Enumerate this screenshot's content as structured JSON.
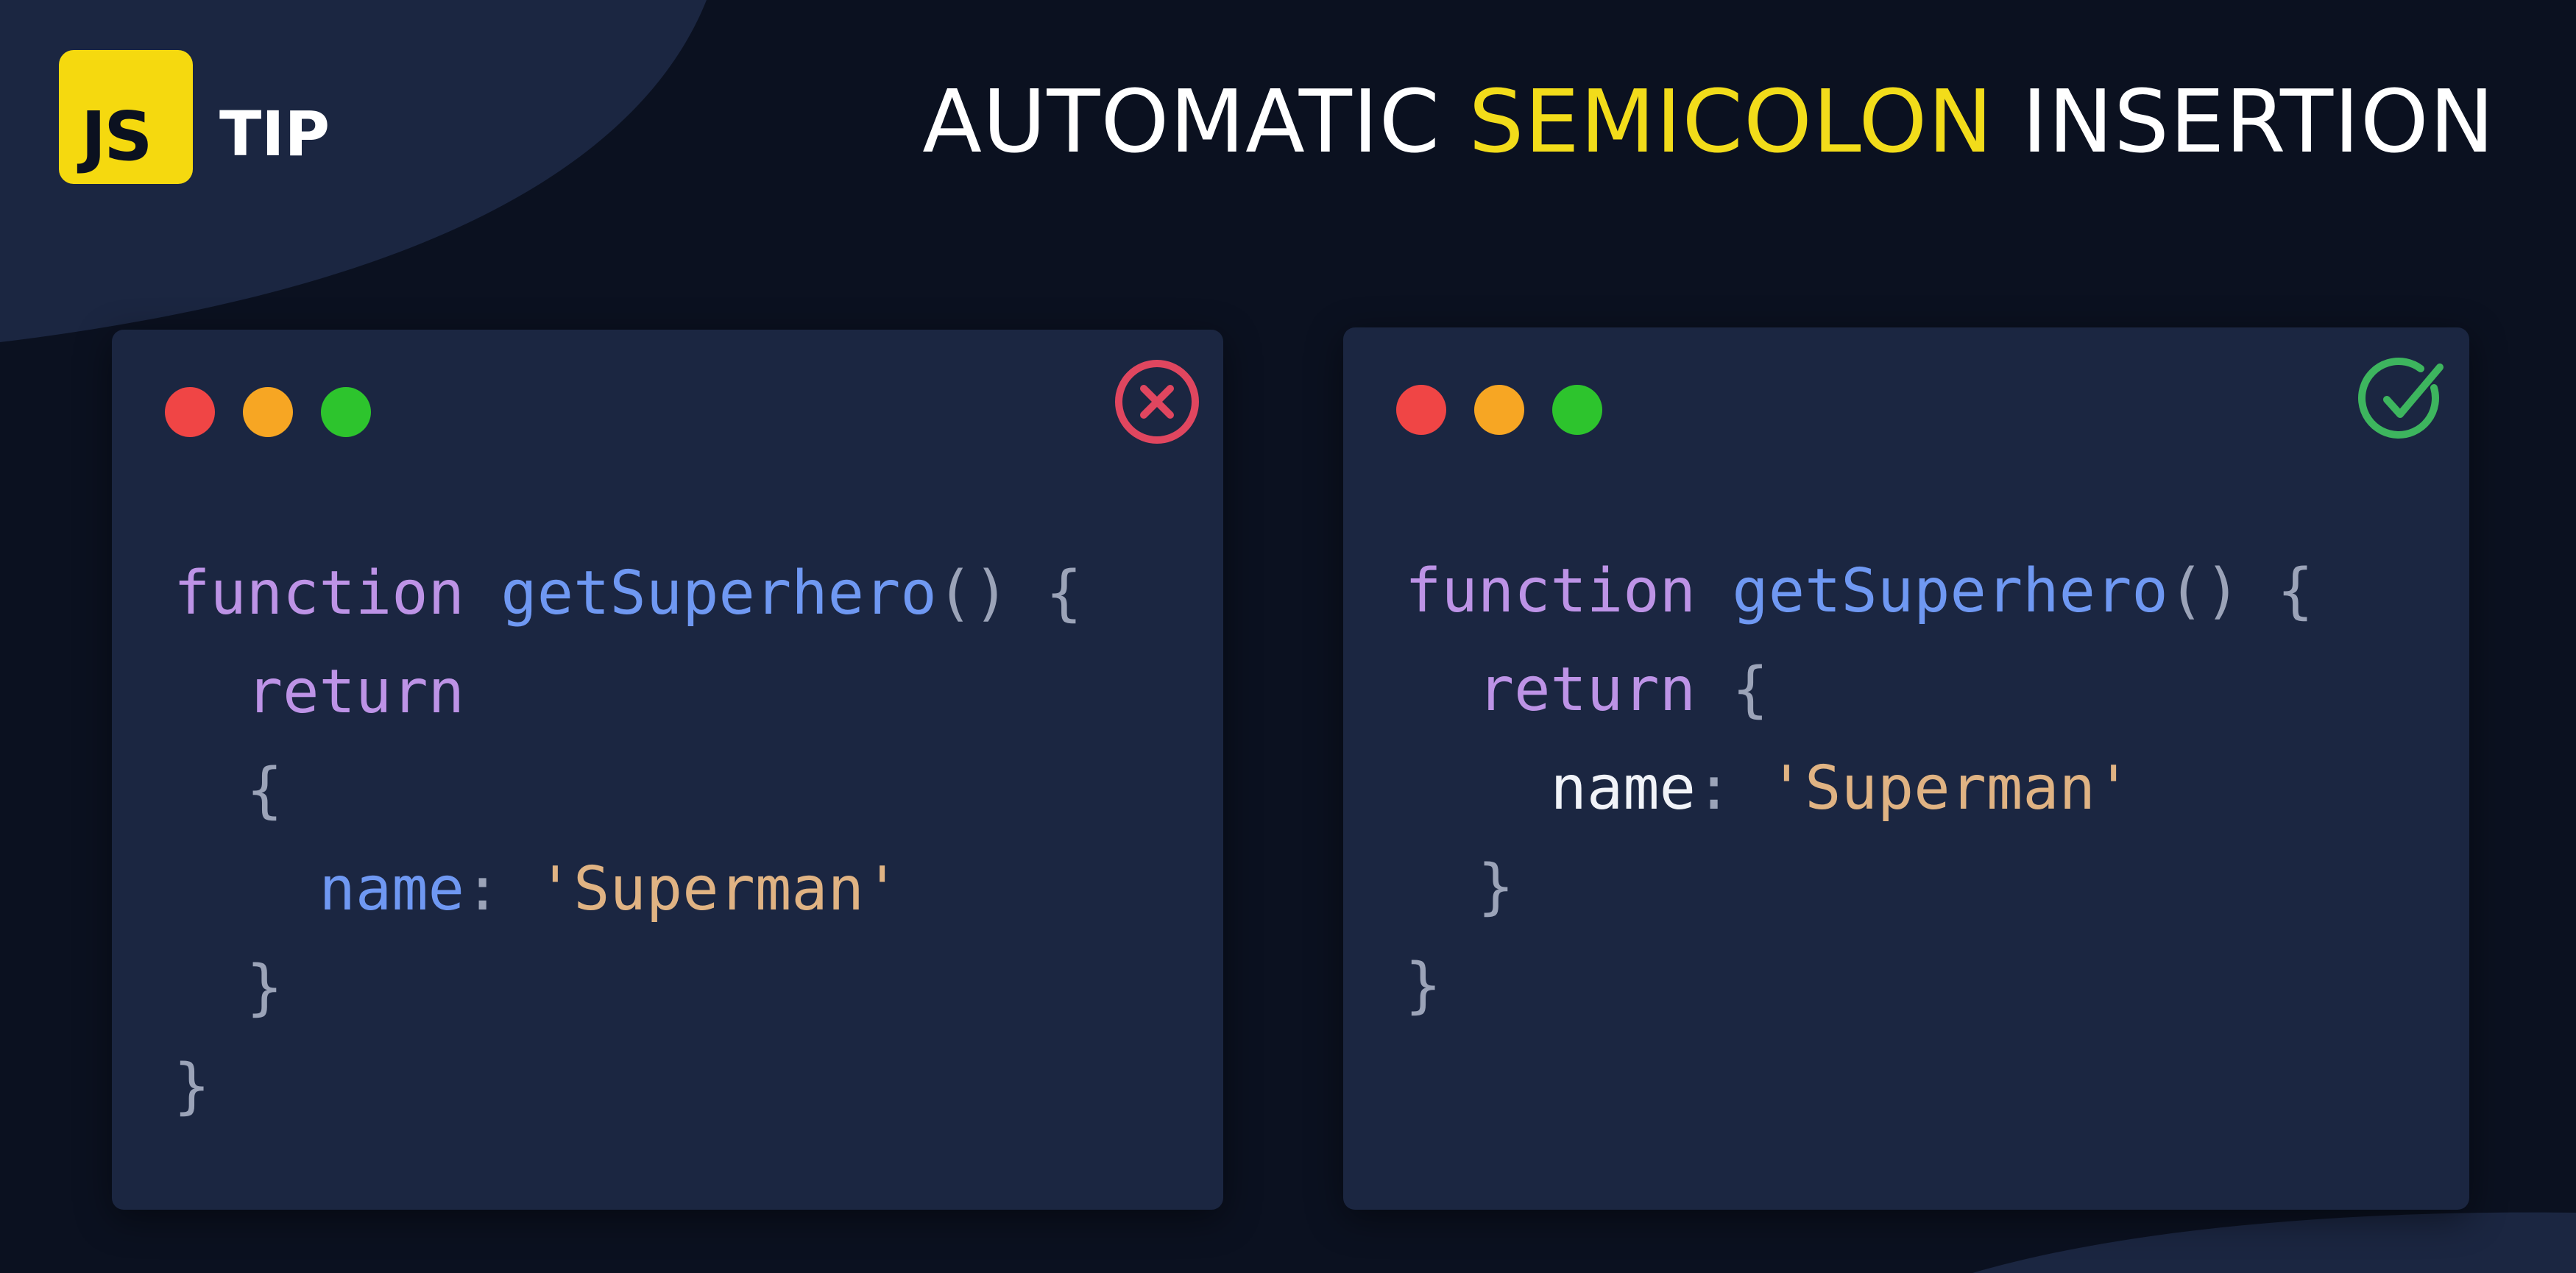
{
  "badge": {
    "logo_text": "JS",
    "tip_label": "TIP"
  },
  "title": {
    "part1": "AUTOMATIC ",
    "highlight": "SEMICOLON",
    "part2": " INSERTION"
  },
  "colors": {
    "background": "#0b1120",
    "blob": "#1b2641",
    "window": "#1b2641",
    "brand_yellow": "#f5d90f",
    "title_highlight": "#f2dc1a",
    "dot_red": "#f04545",
    "dot_yellow": "#f7a623",
    "dot_green": "#2dc42d",
    "error": "#e0465f",
    "success": "#3db55e",
    "keyword": "#bd93e6",
    "function_name": "#6f98f2",
    "punctuation": "#9ba3b8",
    "property_bad": "#6f98f2",
    "property_good": "#f1f3f8",
    "string": "#e0b383"
  },
  "windows": [
    {
      "id": "incorrect",
      "status_icon": "x-circle-icon",
      "status_color": "#e0465f",
      "lines": [
        [
          {
            "text": "function",
            "cls": "keyword"
          },
          {
            "text": " ",
            "cls": "plain"
          },
          {
            "text": "getSuperhero",
            "cls": "function_name"
          },
          {
            "text": "() {",
            "cls": "punctuation"
          }
        ],
        [
          {
            "text": "  ",
            "cls": "plain"
          },
          {
            "text": "return",
            "cls": "keyword"
          }
        ],
        [
          {
            "text": "  {",
            "cls": "punctuation"
          }
        ],
        [
          {
            "text": "    ",
            "cls": "plain"
          },
          {
            "text": "name",
            "cls": "property_bad"
          },
          {
            "text": ": ",
            "cls": "punctuation"
          },
          {
            "text": "'Superman'",
            "cls": "string"
          }
        ],
        [
          {
            "text": "  }",
            "cls": "punctuation"
          }
        ],
        [
          {
            "text": "}",
            "cls": "punctuation"
          }
        ]
      ]
    },
    {
      "id": "correct",
      "status_icon": "check-circle-icon",
      "status_color": "#3db55e",
      "lines": [
        [
          {
            "text": "function",
            "cls": "keyword"
          },
          {
            "text": " ",
            "cls": "plain"
          },
          {
            "text": "getSuperhero",
            "cls": "function_name"
          },
          {
            "text": "() {",
            "cls": "punctuation"
          }
        ],
        [
          {
            "text": "  ",
            "cls": "plain"
          },
          {
            "text": "return",
            "cls": "keyword"
          },
          {
            "text": " {",
            "cls": "punctuation"
          }
        ],
        [
          {
            "text": "    ",
            "cls": "plain"
          },
          {
            "text": "name",
            "cls": "property_good"
          },
          {
            "text": ": ",
            "cls": "punctuation"
          },
          {
            "text": "'Superman'",
            "cls": "string"
          }
        ],
        [
          {
            "text": "  }",
            "cls": "punctuation"
          }
        ],
        [
          {
            "text": "}",
            "cls": "punctuation"
          }
        ]
      ]
    }
  ]
}
